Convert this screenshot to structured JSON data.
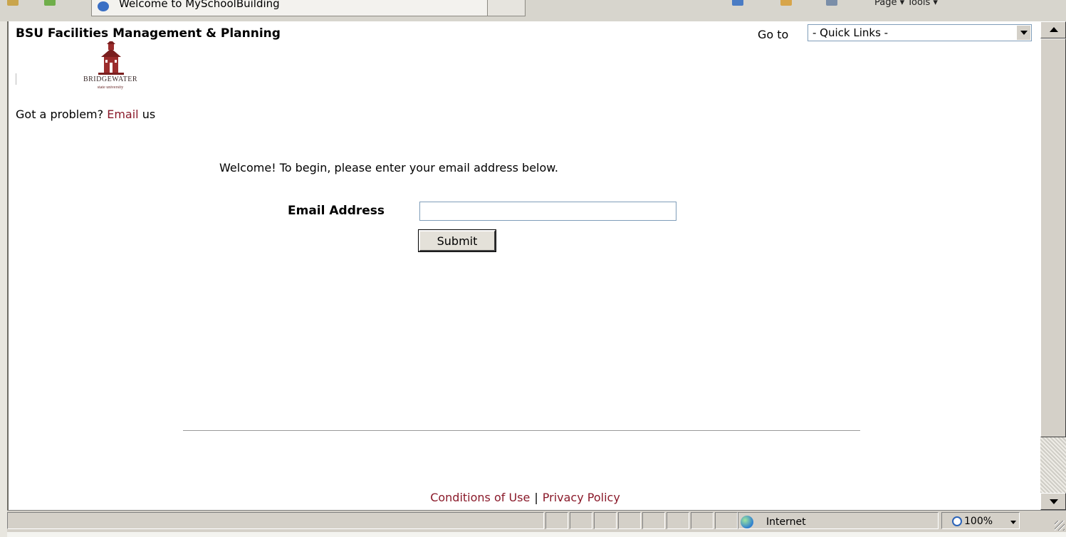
{
  "browser": {
    "tab_title": "Welcome to MySchoolBuilding",
    "tools_text": "Page ▾   Tools ▾"
  },
  "header": {
    "site_title": "BSU Facilities Management & Planning",
    "goto_label": "Go to",
    "quick_links_value": "- Quick Links -"
  },
  "logo": {
    "caption": "BRIDGEWATER",
    "tagline": "state university"
  },
  "problem": {
    "prefix": "Got a problem?",
    "link": "Email",
    "suffix": "us"
  },
  "main": {
    "welcome": "Welcome! To begin, please enter your email address below.",
    "email_label": "Email Address",
    "email_value": "",
    "submit_label": "Submit"
  },
  "footer": {
    "conditions": "Conditions of Use",
    "separator": "|",
    "privacy": "Privacy Policy"
  },
  "statusbar": {
    "zone": "Internet",
    "zoom": "100%"
  },
  "colors": {
    "link": "#8a1a2a",
    "logo_red": "#9b2c2c"
  }
}
